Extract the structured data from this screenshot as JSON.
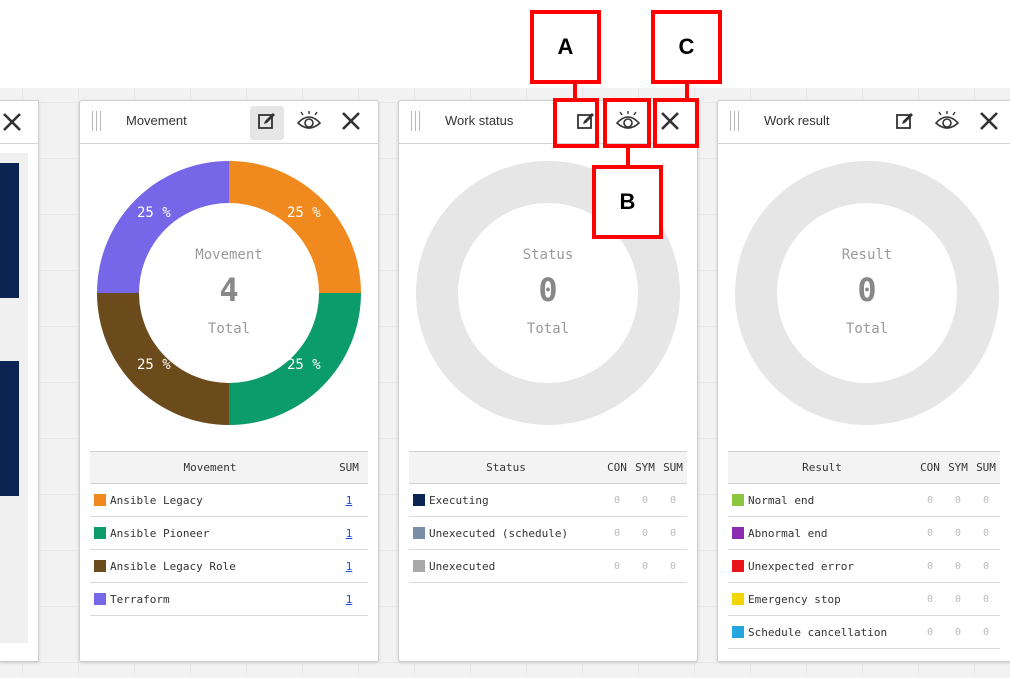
{
  "callouts": {
    "a": "A",
    "b": "B",
    "c": "C"
  },
  "cards": {
    "movement": {
      "title": "Movement",
      "center_label": "Movement",
      "center_value": "4",
      "center_total": "Total",
      "slices": [
        {
          "label": "25 %",
          "value": 25,
          "color": "#f08a1e"
        },
        {
          "label": "25 %",
          "value": 25,
          "color": "#0c9b6b"
        },
        {
          "label": "25 %",
          "value": 25,
          "color": "#6b4a1b"
        },
        {
          "label": "25 %",
          "value": 25,
          "color": "#7567e8"
        }
      ],
      "header": [
        "Movement",
        "SUM"
      ],
      "rows": [
        {
          "name": "Ansible Legacy",
          "color": "#f08a1e",
          "sum": "1"
        },
        {
          "name": "Ansible Pioneer",
          "color": "#0c9b6b",
          "sum": "1"
        },
        {
          "name": "Ansible Legacy Role",
          "color": "#6b4a1b",
          "sum": "1"
        },
        {
          "name": "Terraform",
          "color": "#7567e8",
          "sum": "1"
        }
      ]
    },
    "status": {
      "title": "Work status",
      "center_label": "Status",
      "center_value": "0",
      "center_total": "Total",
      "header": [
        "Status",
        "CON",
        "SYM",
        "SUM"
      ],
      "rows": [
        {
          "name": "Executing",
          "color": "#0b2451",
          "con": "0",
          "sym": "0",
          "sum": "0"
        },
        {
          "name": "Unexecuted (schedule)",
          "color": "#7a8ea8",
          "con": "0",
          "sym": "0",
          "sum": "0"
        },
        {
          "name": "Unexecuted",
          "color": "#a9a9a9",
          "con": "0",
          "sym": "0",
          "sum": "0"
        }
      ]
    },
    "result": {
      "title": "Work result",
      "center_label": "Result",
      "center_value": "0",
      "center_total": "Total",
      "header": [
        "Result",
        "CON",
        "SYM",
        "SUM"
      ],
      "rows": [
        {
          "name": "Normal end",
          "color": "#8cc63f",
          "con": "0",
          "sym": "0",
          "sum": "0"
        },
        {
          "name": "Abnormal end",
          "color": "#8a2bb0",
          "con": "0",
          "sym": "0",
          "sum": "0"
        },
        {
          "name": "Unexpected error",
          "color": "#e8141a",
          "con": "0",
          "sym": "0",
          "sum": "0"
        },
        {
          "name": "Emergency stop",
          "color": "#f2d600",
          "con": "0",
          "sym": "0",
          "sum": "0"
        },
        {
          "name": "Schedule cancellation",
          "color": "#26a5e0",
          "con": "0",
          "sym": "0",
          "sum": "0"
        }
      ]
    }
  },
  "icons": {
    "edit": "edit-icon",
    "view": "eye-icon",
    "close": "close-icon",
    "drag": "drag-handle-icon"
  }
}
